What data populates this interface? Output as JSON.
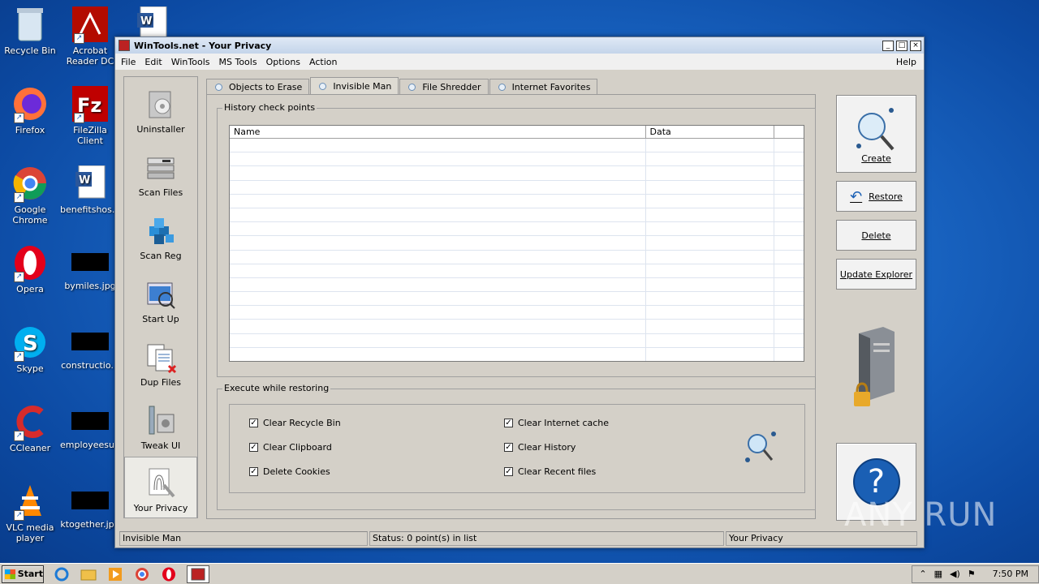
{
  "desktop": {
    "icons": [
      {
        "label": "Recycle Bin"
      },
      {
        "label": "Acrobat Reader DC"
      },
      {
        "label": "Firefox"
      },
      {
        "label": "FileZilla Client"
      },
      {
        "label": "Google Chrome"
      },
      {
        "label": "benefitshos..."
      },
      {
        "label": "Opera"
      },
      {
        "label": "bymiles.jpg"
      },
      {
        "label": "Skype"
      },
      {
        "label": "constructio..."
      },
      {
        "label": "CCleaner"
      },
      {
        "label": "employeesu..."
      },
      {
        "label": "VLC media player"
      },
      {
        "label": "ktogether.jpg"
      }
    ]
  },
  "window": {
    "title": "WinTools.net - Your Privacy",
    "controls": {
      "minimize": "_",
      "maximize": "□",
      "close": "×"
    }
  },
  "menubar": {
    "items": [
      "File",
      "Edit",
      "WinTools",
      "MS Tools",
      "Options",
      "Action"
    ],
    "help": "Help"
  },
  "leftnav": {
    "items": [
      {
        "label": "Uninstaller"
      },
      {
        "label": "Scan Files"
      },
      {
        "label": "Scan Reg"
      },
      {
        "label": "Start Up"
      },
      {
        "label": "Dup Files"
      },
      {
        "label": "Tweak UI"
      },
      {
        "label": "Your Privacy"
      }
    ]
  },
  "tabs": [
    {
      "label": "Objects to Erase"
    },
    {
      "label": "Invisible Man"
    },
    {
      "label": "File Shredder"
    },
    {
      "label": "Internet Favorites"
    }
  ],
  "history": {
    "legend": "History check points",
    "columns": [
      "Name",
      "Data"
    ]
  },
  "execute": {
    "legend": "Execute while restoring",
    "options_left": [
      {
        "label": "Clear Recycle Bin",
        "checked": true
      },
      {
        "label": "Clear Clipboard",
        "checked": true
      },
      {
        "label": "Delete Cookies",
        "checked": true
      }
    ],
    "options_right": [
      {
        "label": "Clear Internet cache",
        "checked": true
      },
      {
        "label": "Clear History",
        "checked": true
      },
      {
        "label": "Clear Recent files",
        "checked": true
      }
    ],
    "check_mark": "✓"
  },
  "buttons": {
    "create": "Create",
    "restore": "Restore",
    "delete": "Delete",
    "update_explorer": "Update Explorer",
    "help_symbol": "?"
  },
  "statusbar": {
    "left": "Invisible Man",
    "middle": "Status: 0 point(s) in list",
    "right": "Your Privacy"
  },
  "taskbar": {
    "start": "Start",
    "clock": "7:50 PM"
  },
  "watermark": "ANY RUN"
}
